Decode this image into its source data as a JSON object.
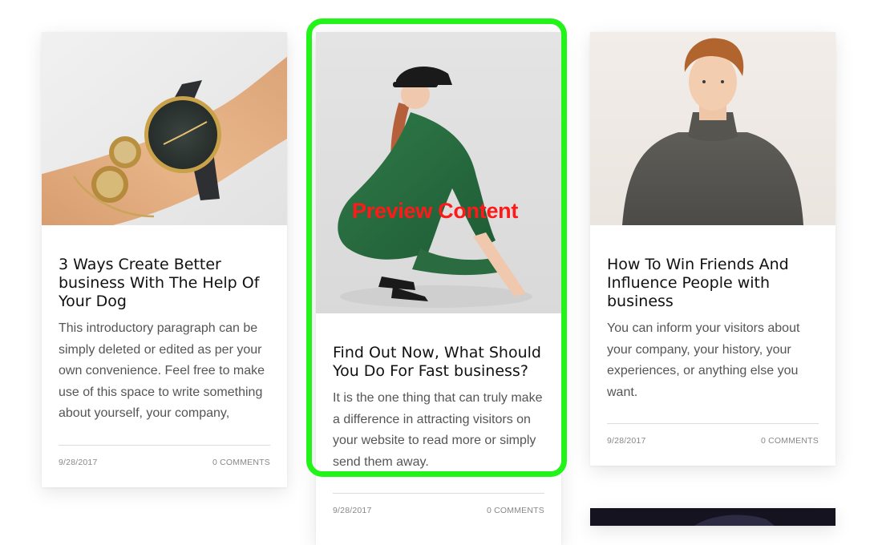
{
  "overlay": {
    "preview_label": "Preview Content",
    "highlight_color": "#22f41a",
    "label_color": "#ff1a1a"
  },
  "posts": [
    {
      "title": "3 Ways Create Better business With The Help Of Your Dog",
      "excerpt": "This introductory paragraph can be simply deleted or edited as per your own convenience. Feel free to make use of this space to write something about yourself, your company,",
      "date": "9/28/2017",
      "comments": "0 COMMENTS",
      "image": "wristwatch-and-bracelets-photo"
    },
    {
      "title": "Find Out Now, What Should You Do For Fast business?",
      "excerpt": "It is the one thing that can truly make a difference in attracting visitors on your website to read more or simply send them away.",
      "date": "9/28/2017",
      "comments": "0 COMMENTS",
      "image": "woman-in-green-dress-and-cap-photo"
    },
    {
      "title": "How To Win Friends And Influence People with business",
      "excerpt": "You can inform your visitors about your company, your history, your experiences, or anything else you want.",
      "date": "9/28/2017",
      "comments": "0 COMMENTS",
      "image": "man-in-gray-sweater-photo"
    },
    {
      "image": "dark-photo"
    }
  ]
}
